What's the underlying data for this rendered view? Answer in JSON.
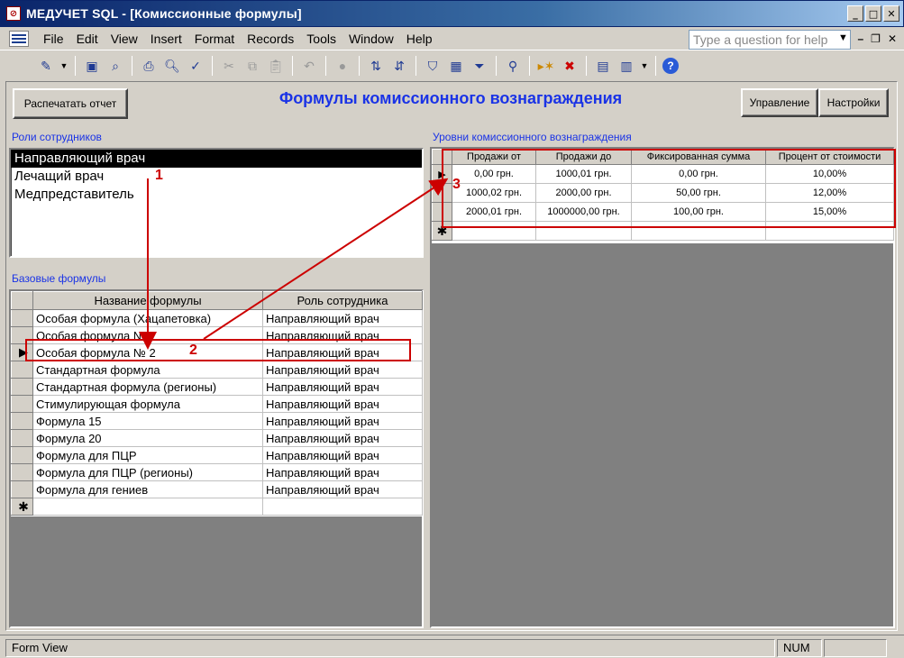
{
  "window": {
    "title": "МЕДУЧЕТ SQL - [Комиссионные формулы]",
    "minimize": "_",
    "maximize": "□",
    "close": "✕"
  },
  "menu": {
    "items": [
      "File",
      "Edit",
      "View",
      "Insert",
      "Format",
      "Records",
      "Tools",
      "Window",
      "Help"
    ],
    "help_placeholder": "Type a question for help"
  },
  "form": {
    "print_button": "Распечатать отчет",
    "title": "Формулы комиссионного вознаграждения",
    "manage_button": "Управление",
    "settings_button": "Настройки",
    "roles_label": "Роли сотрудников",
    "roles": [
      "Направляющий врач",
      "Лечащий врач",
      "Медпредставитель"
    ],
    "base_label": "Базовые формулы",
    "levels_label": "Уровни комиссионного вознаграждения"
  },
  "base_grid": {
    "headers": [
      "Название формулы",
      "Роль сотрудника"
    ],
    "rows": [
      [
        "Особая формула (Хацапетовка)",
        "Направляющий врач"
      ],
      [
        "Особая формула № 1",
        "Направляющий врач"
      ],
      [
        "Особая формула № 2",
        "Направляющий врач"
      ],
      [
        "Стандартная формула",
        "Направляющий врач"
      ],
      [
        "Стандартная формула (регионы)",
        "Направляющий врач"
      ],
      [
        "Стимулирующая формула",
        "Направляющий врач"
      ],
      [
        "Формула 15",
        "Направляющий врач"
      ],
      [
        "Формула 20",
        "Направляющий врач"
      ],
      [
        "Формула для ПЦР",
        "Направляющий врач"
      ],
      [
        "Формула для ПЦР (регионы)",
        "Направляющий врач"
      ],
      [
        "Формула для гениев",
        "Направляющий врач"
      ]
    ],
    "current_row": 2
  },
  "levels_grid": {
    "headers": [
      "Продажи от",
      "Продажи до",
      "Фиксированная сумма",
      "Процент от стоимости"
    ],
    "rows": [
      [
        "0,00 грн.",
        "1000,01 грн.",
        "0,00 грн.",
        "10,00%"
      ],
      [
        "1000,02 грн.",
        "2000,00 грн.",
        "50,00 грн.",
        "12,00%"
      ],
      [
        "2000,01 грн.",
        "1000000,00 грн.",
        "100,00 грн.",
        "15,00%"
      ]
    ]
  },
  "annotations": [
    "1",
    "2",
    "3"
  ],
  "status": {
    "mode": "Form View",
    "num": "NUM"
  },
  "colors": {
    "accent_blue": "#1a33e6",
    "annotation_red": "#c00000",
    "face": "#d4d0c8"
  }
}
